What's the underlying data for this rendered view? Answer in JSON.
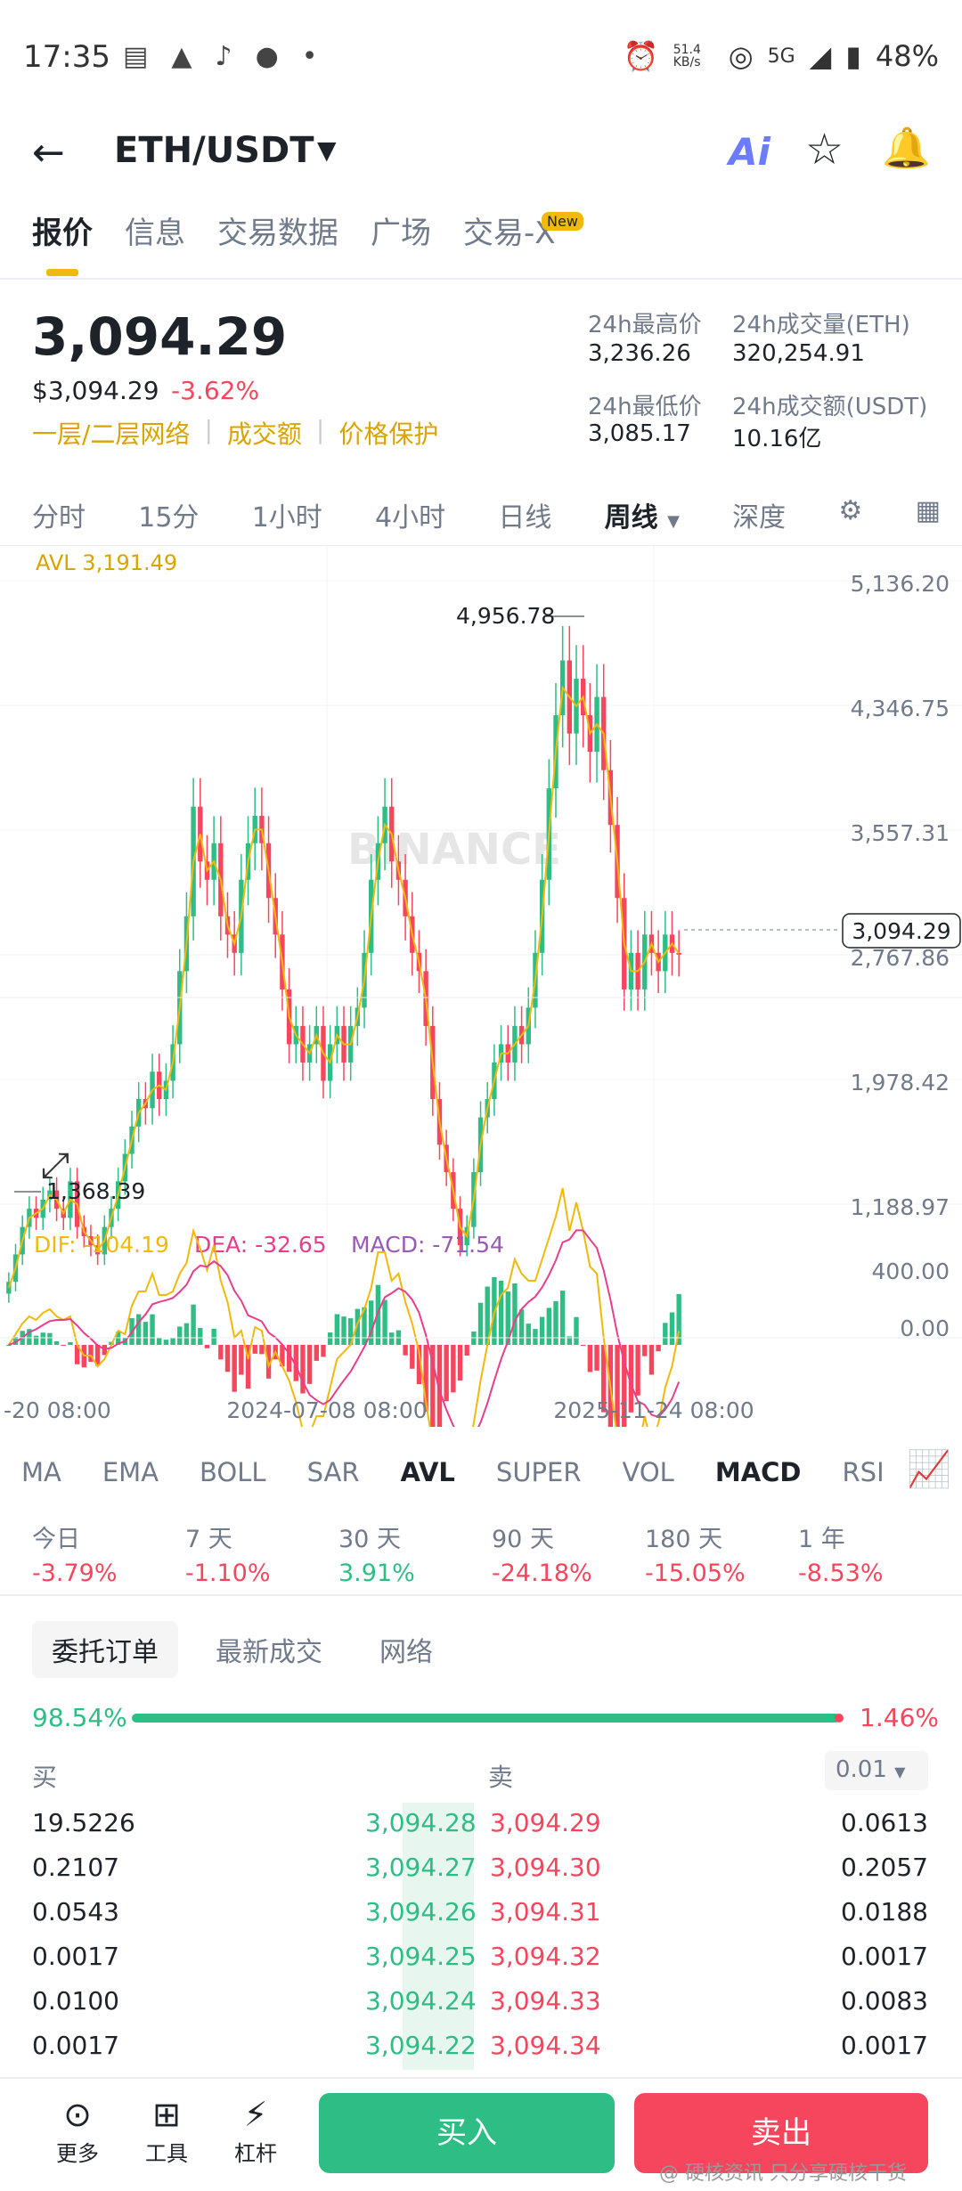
{
  "status_bar": {
    "time": "17:35",
    "net_speed": "51.4 KB/s",
    "network": "5G",
    "battery": "48%"
  },
  "header": {
    "pair": "ETH/USDT",
    "ai_label": "Ai"
  },
  "tabs": [
    "报价",
    "信息",
    "交易数据",
    "广场",
    "交易-X"
  ],
  "tab_new_badge": "New",
  "price": {
    "last": "3,094.29",
    "usd": "$3,094.29",
    "change": "-3.62%",
    "links": [
      "一层/二层网络",
      "成交额",
      "价格保护"
    ],
    "stats": {
      "high_label": "24h最高价",
      "high_value": "3,236.26",
      "vol_eth_label": "24h成交量(ETH)",
      "vol_eth_value": "320,254.91",
      "low_label": "24h最低价",
      "low_value": "3,085.17",
      "vol_usdt_label": "24h成交额(USDT)",
      "vol_usdt_value": "10.16亿"
    }
  },
  "kline_tabs": [
    "分时",
    "15分",
    "1小时",
    "4小时",
    "日线",
    "周线",
    "深度"
  ],
  "kline_active": "周线",
  "chart_data": {
    "type": "candlestick",
    "avl_label": "AVL 3,191.49",
    "y_ticks": [
      "5,136.20",
      "4,346.75",
      "3,557.31",
      "2,767.86",
      "1,978.42",
      "1,188.97"
    ],
    "x_ticks": [
      "-20 08:00",
      "2024-07-08 08:00",
      "2025-11-24 08:00"
    ],
    "high_marker": "4,956.78",
    "low_marker": "1,368.39",
    "current_price": "3,094.29",
    "watermark": "BINANCE",
    "macd": {
      "dif_label": "DIF: -104.19",
      "dea_label": "DEA: -32.65",
      "macd_label": "MACD: -71.54",
      "y_ticks": [
        "400.00",
        "0.00"
      ]
    },
    "closes": [
      1300,
      1450,
      1600,
      1700,
      1650,
      1750,
      1800,
      1700,
      1650,
      1850,
      1600,
      1550,
      1500,
      1450,
      1600,
      1700,
      1850,
      2000,
      2150,
      2300,
      2250,
      2450,
      2300,
      2400,
      2600,
      3000,
      3300,
      3900,
      3600,
      3500,
      3700,
      3300,
      3200,
      3100,
      3500,
      3700,
      3850,
      3700,
      3400,
      3200,
      2900,
      2600,
      2700,
      2500,
      2600,
      2700,
      2400,
      2600,
      2700,
      2500,
      2700,
      2800,
      3100,
      3500,
      3700,
      3900,
      3600,
      3500,
      3300,
      3100,
      3000,
      2700,
      2300,
      2050,
      1900,
      1700,
      1500,
      1600,
      1900,
      2200,
      2300,
      2500,
      2600,
      2500,
      2700,
      2600,
      2800,
      3100,
      3500,
      4000,
      4400,
      4700,
      4300,
      4600,
      4400,
      4200,
      4500,
      4100,
      3800,
      3400,
      2900,
      3100,
      2900,
      3200,
      3100,
      3000,
      3200,
      3100,
      3094
    ]
  },
  "indicators": [
    "MA",
    "EMA",
    "BOLL",
    "SAR",
    "AVL",
    "SUPER",
    "VOL",
    "MACD",
    "RSI",
    "K"
  ],
  "indicators_active": [
    "AVL",
    "MACD"
  ],
  "performance": [
    {
      "label": "今日",
      "value": "-3.79%",
      "dir": "down"
    },
    {
      "label": "7 天",
      "value": "-1.10%",
      "dir": "down"
    },
    {
      "label": "30 天",
      "value": "3.91%",
      "dir": "up"
    },
    {
      "label": "90 天",
      "value": "-24.18%",
      "dir": "down"
    },
    {
      "label": "180 天",
      "value": "-15.05%",
      "dir": "down"
    },
    {
      "label": "1 年",
      "value": "-8.53%",
      "dir": "down"
    }
  ],
  "orderbook": {
    "tabs": [
      "委托订单",
      "最新成交",
      "网络"
    ],
    "buy_ratio": "98.54%",
    "sell_ratio": "1.46%",
    "buy_label": "买",
    "sell_label": "卖",
    "precision": "0.01",
    "rows": [
      {
        "bid_qty": "19.5226",
        "bid": "3,094.28",
        "ask": "3,094.29",
        "ask_qty": "0.0613"
      },
      {
        "bid_qty": "0.2107",
        "bid": "3,094.27",
        "ask": "3,094.30",
        "ask_qty": "0.2057"
      },
      {
        "bid_qty": "0.0543",
        "bid": "3,094.26",
        "ask": "3,094.31",
        "ask_qty": "0.0188"
      },
      {
        "bid_qty": "0.0017",
        "bid": "3,094.25",
        "ask": "3,094.32",
        "ask_qty": "0.0017"
      },
      {
        "bid_qty": "0.0100",
        "bid": "3,094.24",
        "ask": "3,094.33",
        "ask_qty": "0.0083"
      },
      {
        "bid_qty": "0.0017",
        "bid": "3,094.22",
        "ask": "3,094.34",
        "ask_qty": "0.0017"
      }
    ]
  },
  "bottom": {
    "tools": [
      "更多",
      "工具",
      "杠杆"
    ],
    "buy": "买入",
    "sell": "卖出",
    "watermark": "@ 硬核资讯 只分享硬核干货"
  }
}
